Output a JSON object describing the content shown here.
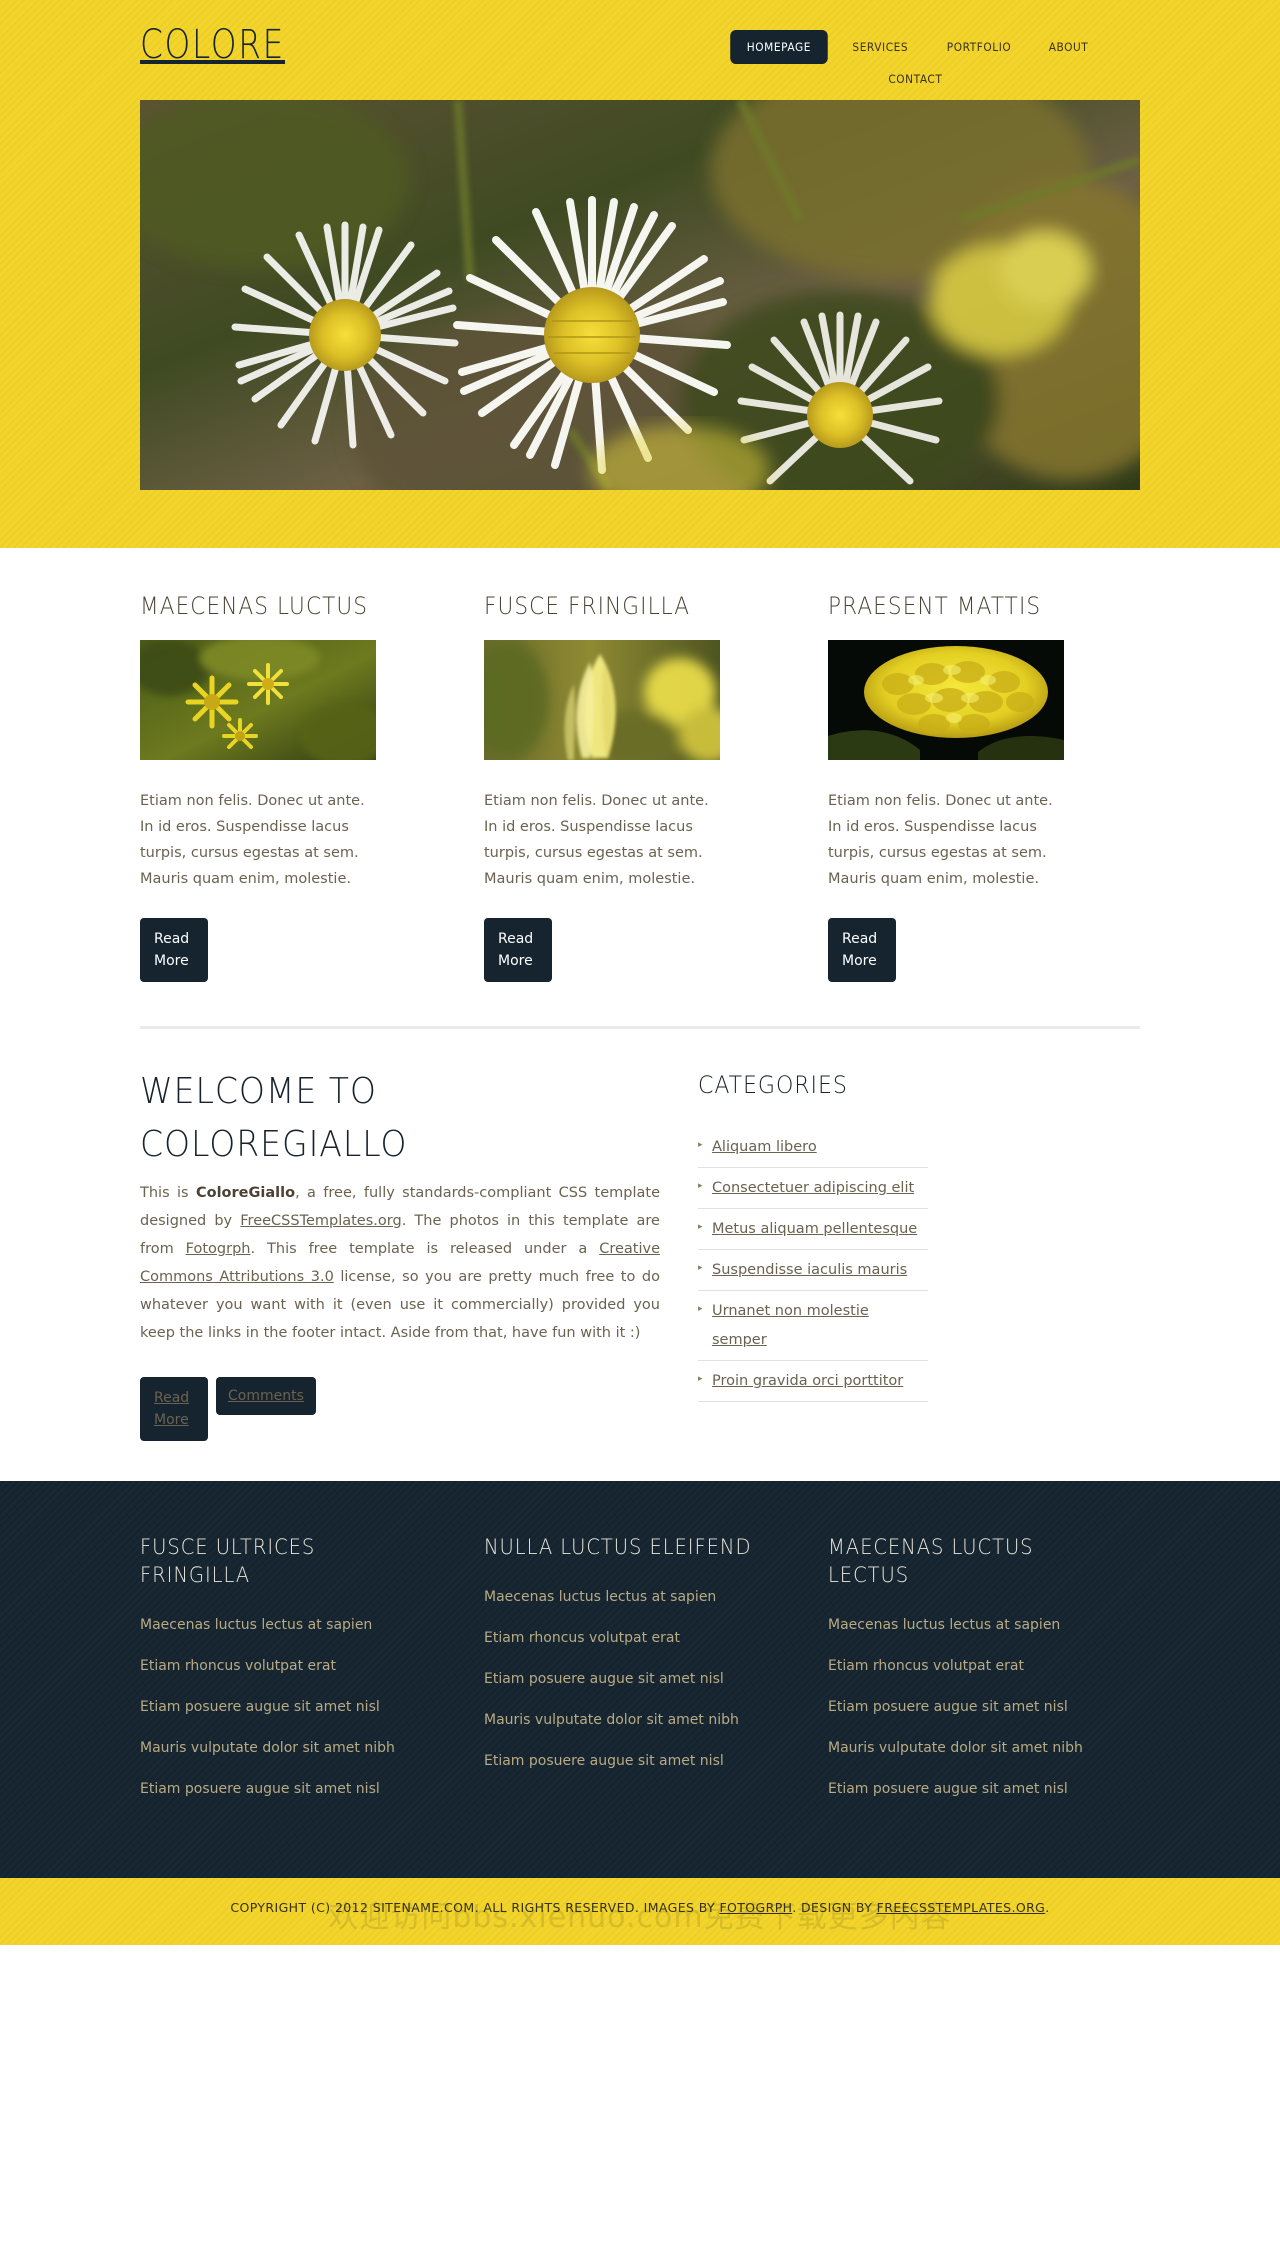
{
  "site": {
    "logo": "COLORE",
    "colors": {
      "accent_yellow": "#f2d42a",
      "dark_navy": "#15242f",
      "body_text": "#6b6250",
      "footer_link": "#b8ab85"
    }
  },
  "nav": {
    "items": [
      {
        "label": "HOMEPAGE",
        "current": true
      },
      {
        "label": "SERVICES",
        "current": false
      },
      {
        "label": "PORTFOLIO",
        "current": false
      },
      {
        "label": "ABOUT",
        "current": false
      },
      {
        "label": "CONTACT",
        "current": false
      }
    ]
  },
  "banner": {
    "alt": "white daisy flowers with yellow centers closeup"
  },
  "boxes": [
    {
      "title": "MAECENAS LUCTUS",
      "image_alt": "yellow wildflowers",
      "text": "Etiam non felis. Donec ut ante. In id eros. Suspendisse lacus turpis, cursus egestas at sem. Mauris quam enim, molestie.",
      "button": "Read More"
    },
    {
      "title": "FUSCE FRINGILLA",
      "image_alt": "yellow tulip bud closeup",
      "text": "Etiam non felis. Donec ut ante. In id eros. Suspendisse lacus turpis, cursus egestas at sem. Mauris quam enim, molestie.",
      "button": "Read More"
    },
    {
      "title": "PRAESENT MATTIS",
      "image_alt": "yellow marigold flower on black",
      "text": "Etiam non felis. Donec ut ante. In id eros. Suspendisse lacus turpis, cursus egestas at sem. Mauris quam enim, molestie.",
      "button": "Read More"
    }
  ],
  "welcome": {
    "title": "WELCOME TO COLOREGIALLO",
    "paragraph": {
      "p1": "This is ",
      "brand": "ColoreGiallo",
      "p2": ", a free, fully standards-compliant CSS template designed by ",
      "link1": "FreeCSSTemplates.org",
      "p3": ". The photos in this template are from ",
      "link2": "Fotogrph",
      "p4": ". This free template is released under a ",
      "link3": "Creative Commons Attributions 3.0",
      "p5": " license, so you are pretty much free to do whatever you want with it (even use it commercially) provided you keep the links in the footer intact. Aside from that, have fun with it :)"
    },
    "read_more": "Read More",
    "comments": "Comments"
  },
  "sidebar": {
    "title": "CATEGORIES",
    "items": [
      "Aliquam libero",
      "Consectetuer adipiscing elit",
      "Metus aliquam pellentesque",
      "Suspendisse iaculis mauris",
      "Urnanet non molestie semper",
      "Proin gravida orci porttitor"
    ]
  },
  "footer": {
    "columns": [
      {
        "title": "FUSCE ULTRICES FRINGILLA",
        "links": [
          "Maecenas luctus lectus at sapien",
          "Etiam rhoncus volutpat erat",
          "Etiam posuere augue sit amet nisl",
          "Mauris vulputate dolor sit amet nibh",
          "Etiam posuere augue sit amet nisl"
        ]
      },
      {
        "title": "NULLA LUCTUS ELEIFEND",
        "links": [
          "Maecenas luctus lectus at sapien",
          "Etiam rhoncus volutpat erat",
          "Etiam posuere augue sit amet nisl",
          "Mauris vulputate dolor sit amet nibh",
          "Etiam posuere augue sit amet nisl"
        ]
      },
      {
        "title": "MAECENAS LUCTUS LECTUS",
        "links": [
          "Maecenas luctus lectus at sapien",
          "Etiam rhoncus volutpat erat",
          "Etiam posuere augue sit amet nisl",
          "Mauris vulputate dolor sit amet nibh",
          "Etiam posuere augue sit amet nisl"
        ]
      }
    ]
  },
  "copyright": {
    "part1": "COPYRIGHT (C) 2012 SITENAME.COM. ALL RIGHTS RESERVED. IMAGES BY ",
    "link1": "FOTOGRPH",
    "part2": ". DESIGN BY ",
    "link2": "FREECSSTEMPLATES.ORG",
    "part3": ".",
    "watermark": "欢迎访问bbs.xiehuo.com免费下载更多内容"
  }
}
